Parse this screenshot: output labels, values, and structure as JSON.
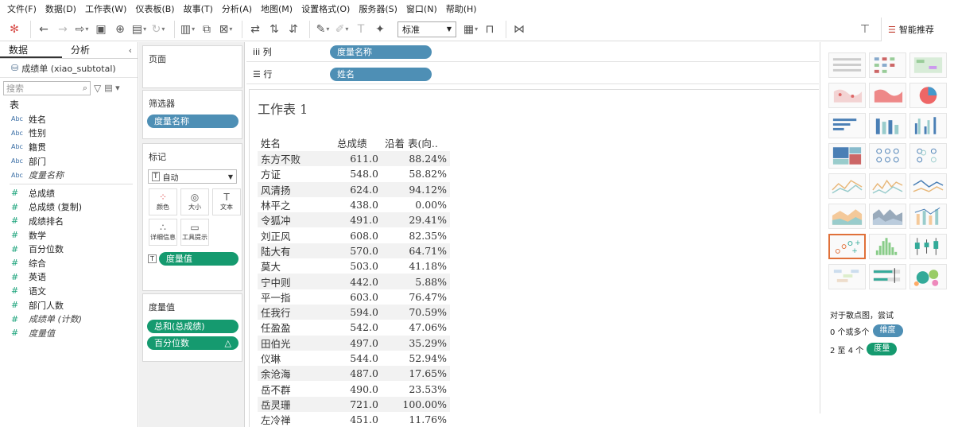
{
  "menu": [
    "文件(F)",
    "数据(D)",
    "工作表(W)",
    "仪表板(B)",
    "故事(T)",
    "分析(A)",
    "地图(M)",
    "设置格式(O)",
    "服务器(S)",
    "窗口(N)",
    "帮助(H)"
  ],
  "toolbar": {
    "view_select": "标准",
    "smart_tab": "智能推荐"
  },
  "left_panel": {
    "tab_data": "数据",
    "tab_analysis": "分析",
    "datasource": "成绩单 (xiao_subtotal)",
    "search_placeholder": "搜索",
    "section_title": "表",
    "dimensions": [
      {
        "type": "Abc",
        "name": "姓名"
      },
      {
        "type": "Abc",
        "name": "性别"
      },
      {
        "type": "Abc",
        "name": "籍贯"
      },
      {
        "type": "Abc",
        "name": "部门"
      },
      {
        "type": "Abc",
        "name": "度量名称"
      }
    ],
    "measures": [
      {
        "type": "#",
        "name": "总成绩"
      },
      {
        "type": "#",
        "name": "总成绩 (复制)"
      },
      {
        "type": "#",
        "name": "成绩排名"
      },
      {
        "type": "#",
        "name": "数学"
      },
      {
        "type": "#",
        "name": "百分位数"
      },
      {
        "type": "#",
        "name": "综合"
      },
      {
        "type": "#",
        "name": "英语"
      },
      {
        "type": "#",
        "name": "语文"
      },
      {
        "type": "#",
        "name": "部门人数"
      },
      {
        "type": "#",
        "name": "成绩单 (计数)"
      },
      {
        "type": "#",
        "name": "度量值"
      }
    ]
  },
  "cards": {
    "pages": "页面",
    "filters": "筛选器",
    "filter_pill": "度量名称",
    "marks": "标记",
    "mark_type": "自动",
    "mark_buttons": [
      "颜色",
      "大小",
      "文本",
      "详细信息",
      "工具提示"
    ],
    "marks_pill": "度量值",
    "measure_values": "度量值",
    "mv_pills": [
      "总和(总成绩)",
      "百分位数"
    ]
  },
  "shelves": {
    "columns_label": "列",
    "columns_pill": "度量名称",
    "rows_label": "行",
    "rows_pill": "姓名"
  },
  "sheet": {
    "title": "工作表 1",
    "headers": [
      "姓名",
      "总成绩",
      "沿着 表(向.."
    ],
    "rows": [
      [
        "东方不败",
        "611.0",
        "88.24%"
      ],
      [
        "方证",
        "548.0",
        "58.82%"
      ],
      [
        "风清扬",
        "624.0",
        "94.12%"
      ],
      [
        "林平之",
        "438.0",
        "0.00%"
      ],
      [
        "令狐冲",
        "491.0",
        "29.41%"
      ],
      [
        "刘正风",
        "608.0",
        "82.35%"
      ],
      [
        "陆大有",
        "570.0",
        "64.71%"
      ],
      [
        "莫大",
        "503.0",
        "41.18%"
      ],
      [
        "宁中则",
        "442.0",
        "5.88%"
      ],
      [
        "平一指",
        "603.0",
        "76.47%"
      ],
      [
        "任我行",
        "594.0",
        "70.59%"
      ],
      [
        "任盈盈",
        "542.0",
        "47.06%"
      ],
      [
        "田伯光",
        "497.0",
        "35.29%"
      ],
      [
        "仪琳",
        "544.0",
        "52.94%"
      ],
      [
        "余沧海",
        "487.0",
        "17.65%"
      ],
      [
        "岳不群",
        "490.0",
        "23.53%"
      ],
      [
        "岳灵珊",
        "721.0",
        "100.00%"
      ],
      [
        "左冷禅",
        "451.0",
        "11.76%"
      ]
    ]
  },
  "show_me": {
    "hint_line1": "对于散点图，尝试",
    "hint_line2_prefix": "0 个或多个",
    "hint_line2_pill": "维度",
    "hint_line3_prefix": "2 至 4 个",
    "hint_line3_pill": "度量"
  },
  "colors": {
    "dimension_pill": "#4e8fb5",
    "measure_pill": "#159a6f",
    "selected_thumb": "#e0713a"
  }
}
